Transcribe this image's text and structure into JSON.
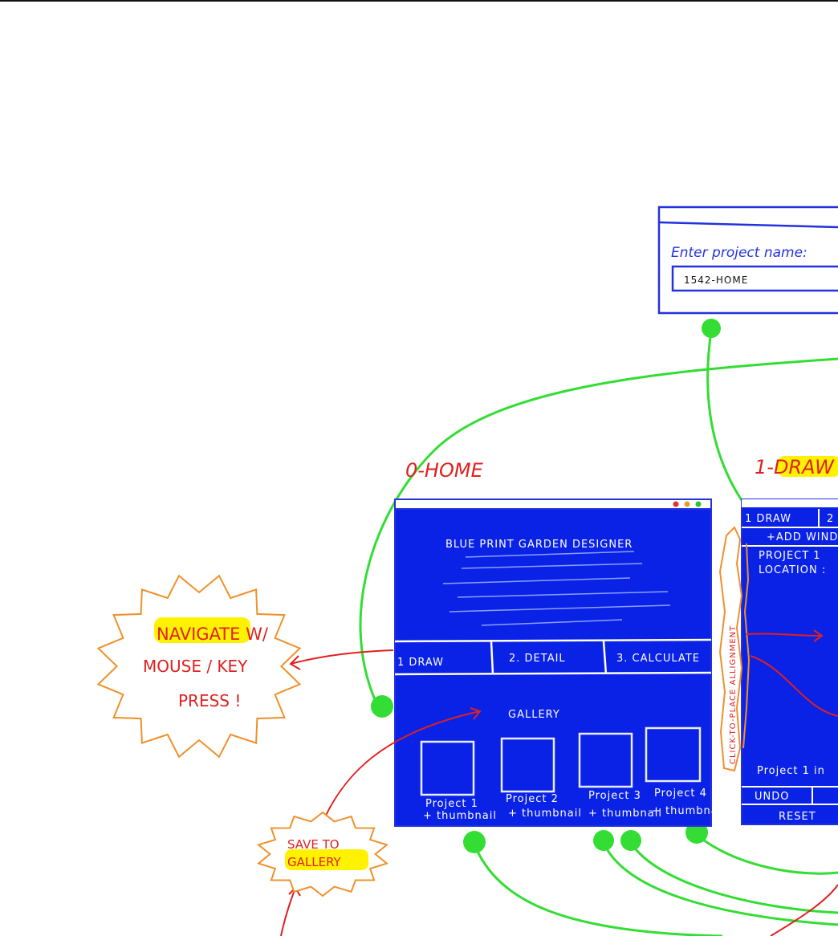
{
  "colors": {
    "blueprint": "#0a22e6",
    "annotation_red": "#e02020",
    "flow_green": "#33dd33",
    "callout_orange": "#f0902a",
    "highlight_yellow": "#fff200"
  },
  "project_dialog": {
    "prompt": "Enter project name:",
    "input_value": "1542-HOME"
  },
  "screens": {
    "home": {
      "label": "0-HOME",
      "window_dots": [
        "#e03030",
        "#e0a030",
        "#30c030"
      ],
      "title": "BLUE PRINT GARDEN DESIGNER",
      "nav": [
        "1 DRAW",
        "2. DETAIL",
        "3. CALCULATE"
      ],
      "gallery_title": "GALLERY",
      "gallery": [
        {
          "name": "Project 1",
          "sub": "+ thumbnail"
        },
        {
          "name": "Project 2",
          "sub": "+ thumbnail"
        },
        {
          "name": "Project 3",
          "sub": "+ thumbnail"
        },
        {
          "name": "Project 4",
          "sub": "+ thumbnail"
        }
      ]
    },
    "draw": {
      "label_prefix": "1-",
      "label_highlight": "DRAW",
      "tab": "1 DRAW",
      "tab2": "2",
      "add_window": "+ADD WINDOW",
      "project": "PROJECT 1",
      "location": "LOCATION :",
      "footer": "Project 1 in",
      "undo": "UNDO",
      "reset": "RESET"
    }
  },
  "callouts": {
    "navigate": {
      "highlight": "NAVIGATE",
      "line1_rest": " W/",
      "line2": "MOUSE / KEY",
      "line3": "PRESS !"
    },
    "save": {
      "line1": "SAVE TO",
      "highlight": "GALLERY"
    },
    "alignment": "CLICK-TO-PLACE ALLIGNMENT"
  }
}
